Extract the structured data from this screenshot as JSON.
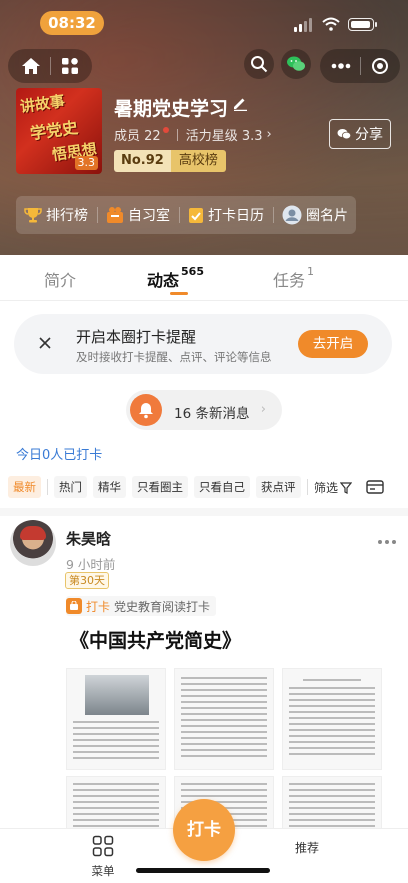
{
  "status_bar": {
    "time": "08:32"
  },
  "group": {
    "title": "暑期党史学习",
    "members_label": "成员 22",
    "vitality_label": "活力星级 3.3",
    "rank_no": "No.92",
    "rank_list": "高校榜",
    "share_label": "分享",
    "cover_score": "3.3",
    "cover_text": [
      "讲故事",
      "学党史",
      "悟思想"
    ]
  },
  "functions": [
    {
      "label": "排行榜",
      "icon": "trophy-icon"
    },
    {
      "label": "自习室",
      "icon": "study-room-icon"
    },
    {
      "label": "打卡日历",
      "icon": "calendar-icon"
    },
    {
      "label": "圈名片",
      "icon": "circle-card-icon"
    }
  ],
  "tabs": [
    {
      "label": "简介",
      "count": ""
    },
    {
      "label": "动态",
      "count": "565"
    },
    {
      "label": "任务",
      "count": "1"
    }
  ],
  "reminder": {
    "title": "开启本圈打卡提醒",
    "subtitle": "及时接收打卡提醒、点评、评论等信息",
    "button": "去开启"
  },
  "news": {
    "label": "16 条新消息"
  },
  "today_checkin": "今日0人已打卡",
  "filters": [
    "最新",
    "热门",
    "精华",
    "只看圈主",
    "只看自己",
    "获点评"
  ],
  "filter_label": "筛选",
  "post": {
    "author": "朱昊晗",
    "time": "9 小时前",
    "day_badge": "第30天",
    "checkin_label": "打卡",
    "checkin_task": "党史教育阅读打卡",
    "title": "《中国共产党简史》"
  },
  "bottom_nav": {
    "menu": "菜单",
    "checkin": "打卡",
    "recommend": "推荐"
  },
  "colors": {
    "accent": "#f08a2a",
    "link": "#3a7bd5",
    "badge": "#e8c46a"
  }
}
